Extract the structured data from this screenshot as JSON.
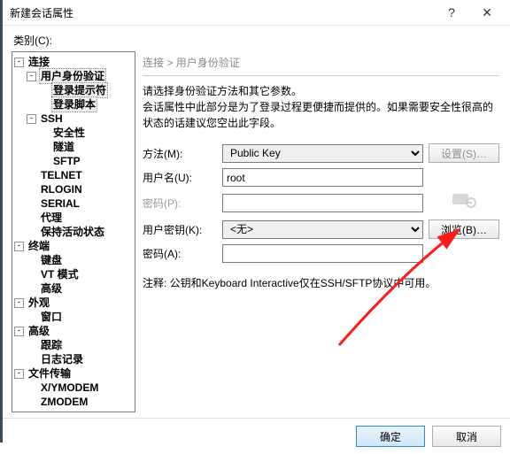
{
  "window": {
    "title": "新建会话属性",
    "help_icon": "?",
    "close_icon": "✕"
  },
  "category_label": "类别(C):",
  "tree": {
    "connection": "连接",
    "auth": "用户身份验证",
    "login_prompt": "登录提示符",
    "login_script": "登录脚本",
    "ssh": "SSH",
    "security": "安全性",
    "tunnel": "隧道",
    "sftp": "SFTP",
    "telnet": "TELNET",
    "rlogin": "RLOGIN",
    "serial": "SERIAL",
    "proxy": "代理",
    "keepalive": "保持活动状态",
    "terminal": "终端",
    "keyboard": "键盘",
    "vtmode": "VT 模式",
    "advanced_t": "高级",
    "appearance": "外观",
    "window": "窗口",
    "advanced": "高级",
    "trace": "跟踪",
    "logging": "日志记录",
    "file_transfer": "文件传输",
    "xymodem": "X/YMODEM",
    "zmodem": "ZMODEM"
  },
  "crumb": {
    "root": "连接",
    "sep": " > ",
    "leaf": "用户身份验证"
  },
  "desc": {
    "l1": "请选择身份验证方法和其它参数。",
    "l2": "会话属性中此部分是为了登录过程更便捷而提供的。如果需要安全性很高的状态的话建议您空出此字段。"
  },
  "form": {
    "method_label": "方法(M):",
    "method_value": "Public Key",
    "settings_btn": "设置(S)…",
    "username_label": "用户名(U):",
    "username_value": "root",
    "password_label": "密码(P):",
    "userkey_label": "用户密钥(K):",
    "userkey_value": "<无>",
    "browse_btn": "浏览(B)…",
    "passphrase_label": "密码(A):"
  },
  "note": "注释: 公钥和Keyboard Interactive仅在SSH/SFTP协议中可用。",
  "buttons": {
    "ok": "确定",
    "cancel": "取消"
  }
}
